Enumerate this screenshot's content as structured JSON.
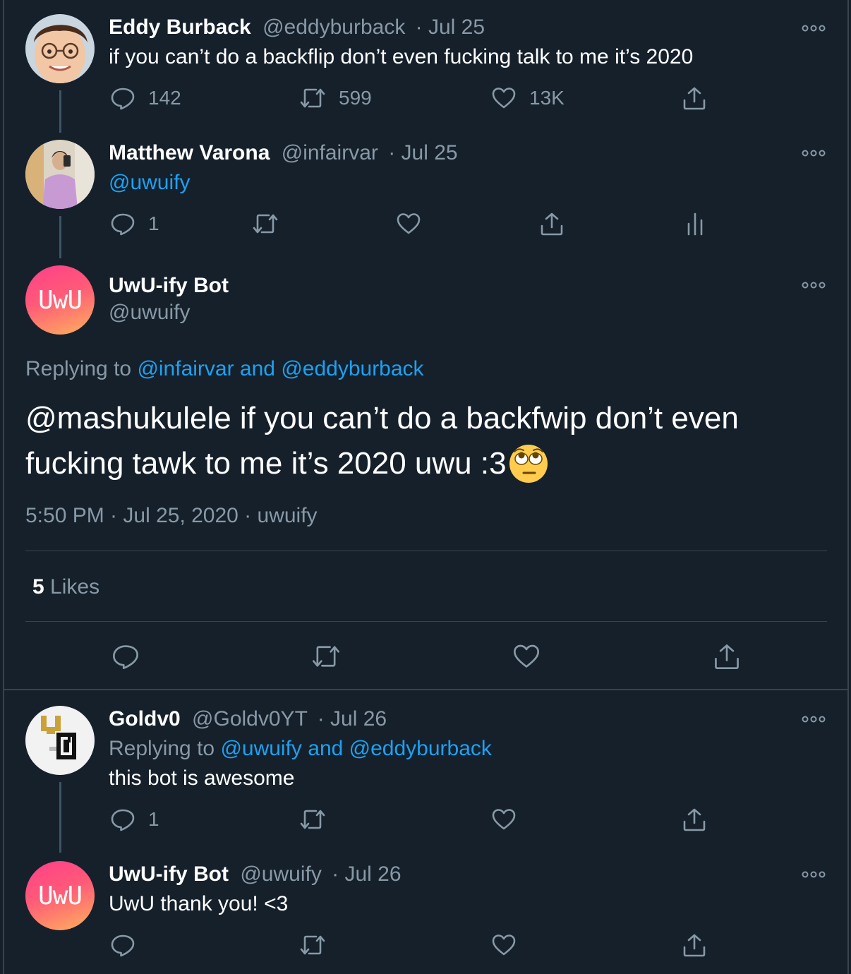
{
  "tweets": [
    {
      "name": "Eddy Burback",
      "handle": "@eddyburback",
      "date": "· Jul 25",
      "text": "if you can’t do a backflip don’t even fucking talk to me it’s 2020",
      "replies": "142",
      "retweets": "599",
      "likes": "13K"
    },
    {
      "name": "Matthew Varona",
      "handle": "@infairvar",
      "date": "· Jul 25",
      "mention": "@uwuify",
      "replies": "1"
    }
  ],
  "main_tweet": {
    "avatar_text": "UwU",
    "name": "UwU-ify Bot",
    "handle": "@uwuify",
    "replying_prefix": "Replying to",
    "replying_targets": "@infairvar and @eddyburback",
    "text_line1": "@mashukulele if you can’t do a backfwip don’t even",
    "text_line2": "fucking tawk to me it’s 2020 uwu :3",
    "emoji": "face-with-rolling-eyes",
    "meta": "5:50 PM · Jul 25, 2020 · uwuify",
    "likes_count": "5",
    "likes_label": "Likes"
  },
  "replies": [
    {
      "name": "Goldv0",
      "handle": "@Goldv0YT",
      "date": "· Jul 26",
      "replying_prefix": "Replying to",
      "replying_targets": "@uwuify and @eddyburback",
      "text": "this bot is awesome",
      "replies": "1"
    },
    {
      "avatar_text": "UwU",
      "name": "UwU-ify Bot",
      "handle": "@uwuify",
      "date": "· Jul 26",
      "text": "UwU thank you! <3"
    }
  ],
  "colors": {
    "background": "#15202b",
    "muted": "#8899a6",
    "link": "#1da1f2",
    "divider": "#38444d"
  }
}
